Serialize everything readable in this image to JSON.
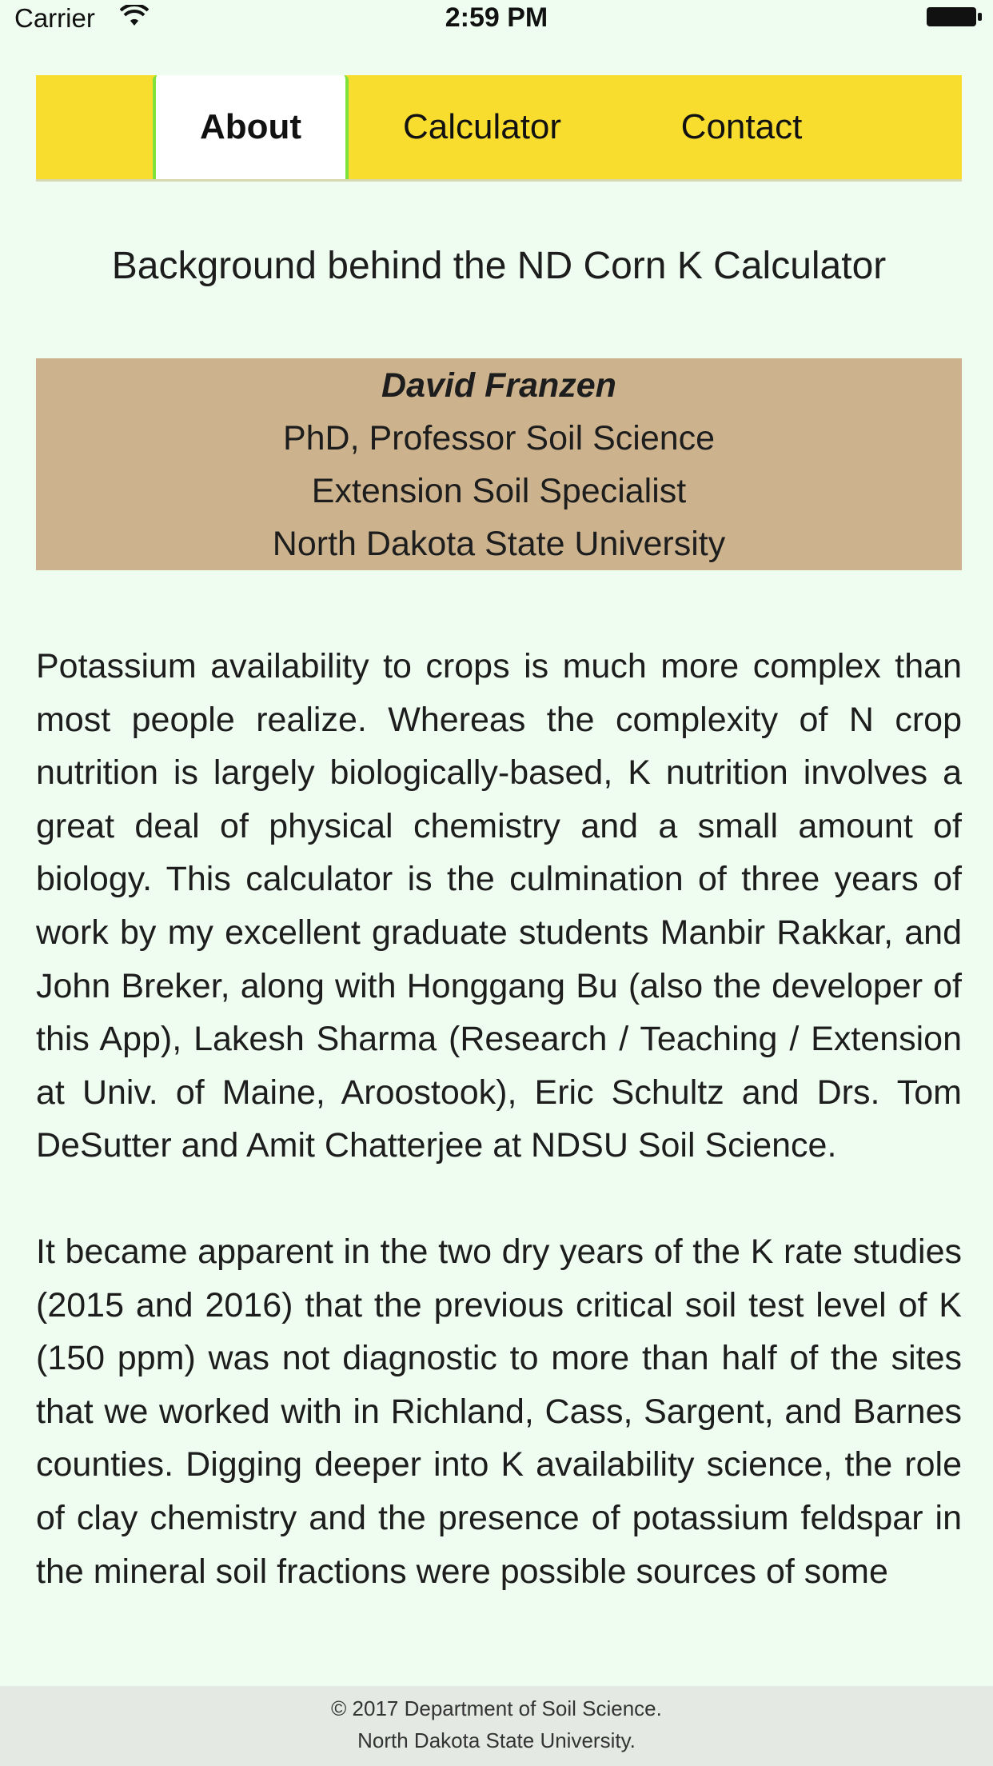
{
  "status_bar": {
    "carrier": "Carrier",
    "time": "2:59 PM"
  },
  "tabs": [
    {
      "label": "About",
      "active": true
    },
    {
      "label": "Calculator",
      "active": false
    },
    {
      "label": "Contact",
      "active": false
    }
  ],
  "page": {
    "title": "Background behind the ND Corn K Calculator"
  },
  "author": {
    "name": "David Franzen",
    "degree": "PhD, Professor Soil Science",
    "role": "Extension Soil Specialist",
    "institution": "North Dakota State University"
  },
  "body": {
    "paragraphs": [
      "Potassium availability to crops is much more complex than most people realize. Whereas the complexity of N crop nutrition is largely biologically-based, K nutrition involves a great deal of physical chemistry and a small amount of biology. This calculator is the culmination of three years of work by my excellent graduate students Manbir Rakkar, and John Breker, along with Honggang Bu (also the developer of this App), Lakesh Sharma (Research / Teaching / Extension at Univ. of Maine, Aroostook), Eric Schultz and Drs. Tom DeSutter and Amit Chatterjee at NDSU Soil Science.",
      "It became apparent in the two dry years of the K rate studies (2015 and 2016) that the previous critical soil test level of K (150 ppm) was not diagnostic to more than half of the sites that we worked with in Richland, Cass, Sargent, and Barnes counties. Digging deeper into K availability science, the role of clay chemistry and the presence of potassium feldspar in the mineral soil fractions were possible sources of some"
    ]
  },
  "footer": {
    "copyright": "© 2017 Department of Soil Science.",
    "university": "North Dakota State University."
  },
  "colors": {
    "background": "#eefdf0",
    "tab_bar": "#f8dd2f",
    "active_tab_border": "#7fe23c",
    "author_card": "#ccb38e"
  }
}
